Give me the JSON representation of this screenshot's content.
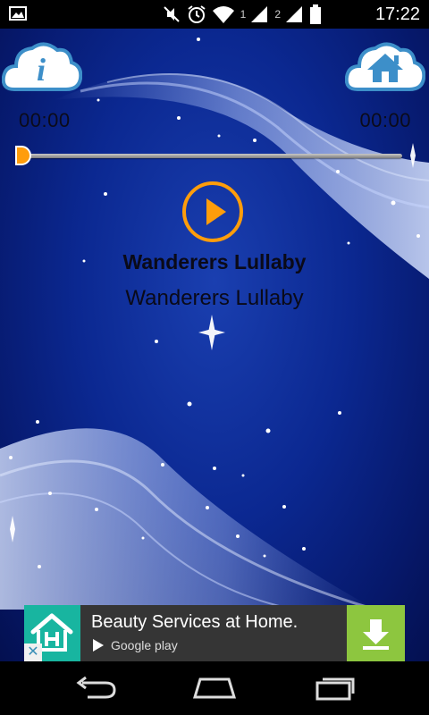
{
  "status_bar": {
    "time": "17:22",
    "sim1_label": "1",
    "sim2_label": "2",
    "icons": [
      "image-notification-icon",
      "mute-icon",
      "alarm-icon",
      "wifi-icon",
      "signal-icon",
      "battery-icon"
    ]
  },
  "player": {
    "elapsed_time": "00:00",
    "total_time": "00:00",
    "progress": 0,
    "song_title": "Wanderers Lullaby",
    "song_artist": "Wanderers Lullaby",
    "info_icon_glyph": "i"
  },
  "ad": {
    "title": "Beauty Services at Home.",
    "store_label": "Google play",
    "close_glyph": "✕"
  },
  "colors": {
    "accent_orange": "#ff9d0b",
    "background_blue": "#0b2891",
    "ad_green": "#8dc63f",
    "ad_teal": "#18b5a0"
  }
}
